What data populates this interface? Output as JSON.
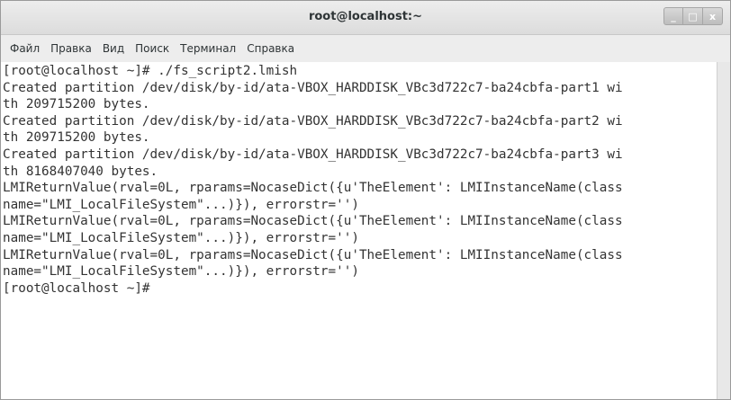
{
  "window": {
    "title": "root@localhost:~"
  },
  "window_controls": {
    "minimize": "_",
    "maximize": "□",
    "close": "x"
  },
  "menubar": {
    "items": [
      {
        "label": "Файл"
      },
      {
        "label": "Правка"
      },
      {
        "label": "Вид"
      },
      {
        "label": "Поиск"
      },
      {
        "label": "Терминал"
      },
      {
        "label": "Справка"
      }
    ]
  },
  "terminal": {
    "lines": [
      "[root@localhost ~]# ./fs_script2.lmish",
      "Created partition /dev/disk/by-id/ata-VBOX_HARDDISK_VBc3d722c7-ba24cbfa-part1 wi",
      "th 209715200 bytes.",
      "Created partition /dev/disk/by-id/ata-VBOX_HARDDISK_VBc3d722c7-ba24cbfa-part2 wi",
      "th 209715200 bytes.",
      "Created partition /dev/disk/by-id/ata-VBOX_HARDDISK_VBc3d722c7-ba24cbfa-part3 wi",
      "th 8168407040 bytes.",
      "LMIReturnValue(rval=0L, rparams=NocaseDict({u'TheElement': LMIInstanceName(class",
      "name=\"LMI_LocalFileSystem\"...)}), errorstr='')",
      "LMIReturnValue(rval=0L, rparams=NocaseDict({u'TheElement': LMIInstanceName(class",
      "name=\"LMI_LocalFileSystem\"...)}), errorstr='')",
      "LMIReturnValue(rval=0L, rparams=NocaseDict({u'TheElement': LMIInstanceName(class",
      "name=\"LMI_LocalFileSystem\"...)}), errorstr='')",
      "[root@localhost ~]#"
    ]
  }
}
